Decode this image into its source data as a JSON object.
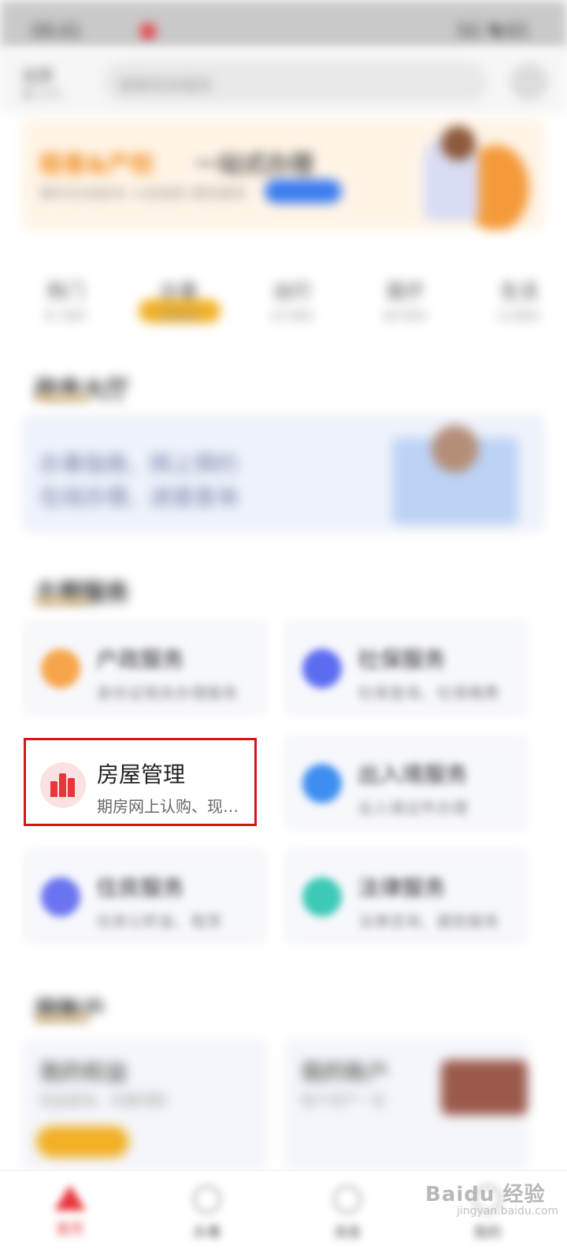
{
  "status_bar": {
    "time": "09:41",
    "right": "5G ◥ 83"
  },
  "header": {
    "city": "北京",
    "city_sub": "晴 17℃",
    "search_placeholder": "搜索政务服务"
  },
  "banner": {
    "title_accent": "租客&产权",
    "title_rest": "一站式办理",
    "subtitle": "随时在线查询 入驻指南 便民服务"
  },
  "tabs": [
    {
      "label": "热门",
      "sub": "热门服务"
    },
    {
      "label": "办事",
      "sub": "办事服务"
    },
    {
      "label": "出行",
      "sub": "出行服务"
    },
    {
      "label": "医疗",
      "sub": "医疗服务"
    },
    {
      "label": "生活",
      "sub": "生活服务"
    }
  ],
  "hall": {
    "title": "政务大厅",
    "line1": "办事指南、网上预约",
    "line2": "在线办理、进度查询"
  },
  "themes": {
    "title": "主题服务",
    "items": [
      {
        "title": "户政服务",
        "desc": "身份证相关办理服务"
      },
      {
        "title": "社保服务",
        "desc": "社保查询、社保缴费"
      },
      {
        "title": "房屋管理",
        "desc": "期房网上认购、现…"
      },
      {
        "title": "出入境服务",
        "desc": "出入境证件办理"
      },
      {
        "title": "住房服务",
        "desc": "住房公积金、租赁"
      },
      {
        "title": "法律服务",
        "desc": "法律咨询、援助服务"
      }
    ]
  },
  "accounts": {
    "title": "我账户",
    "cards": [
      {
        "title": "我的权益",
        "sub": "权益查询、优惠领取"
      },
      {
        "title": "我的账户",
        "sub": "账户资产一览"
      }
    ]
  },
  "tabbar": [
    {
      "label": "首页"
    },
    {
      "label": "办事"
    },
    {
      "label": "消息"
    },
    {
      "label": "我的"
    }
  ],
  "watermark": {
    "text": "Baidu 经验",
    "sub": "jingyan.baidu.com"
  },
  "colors": {
    "accent_red": "#e8343a",
    "highlight_border": "#d4151a",
    "tab_pill": "#f2b024"
  }
}
